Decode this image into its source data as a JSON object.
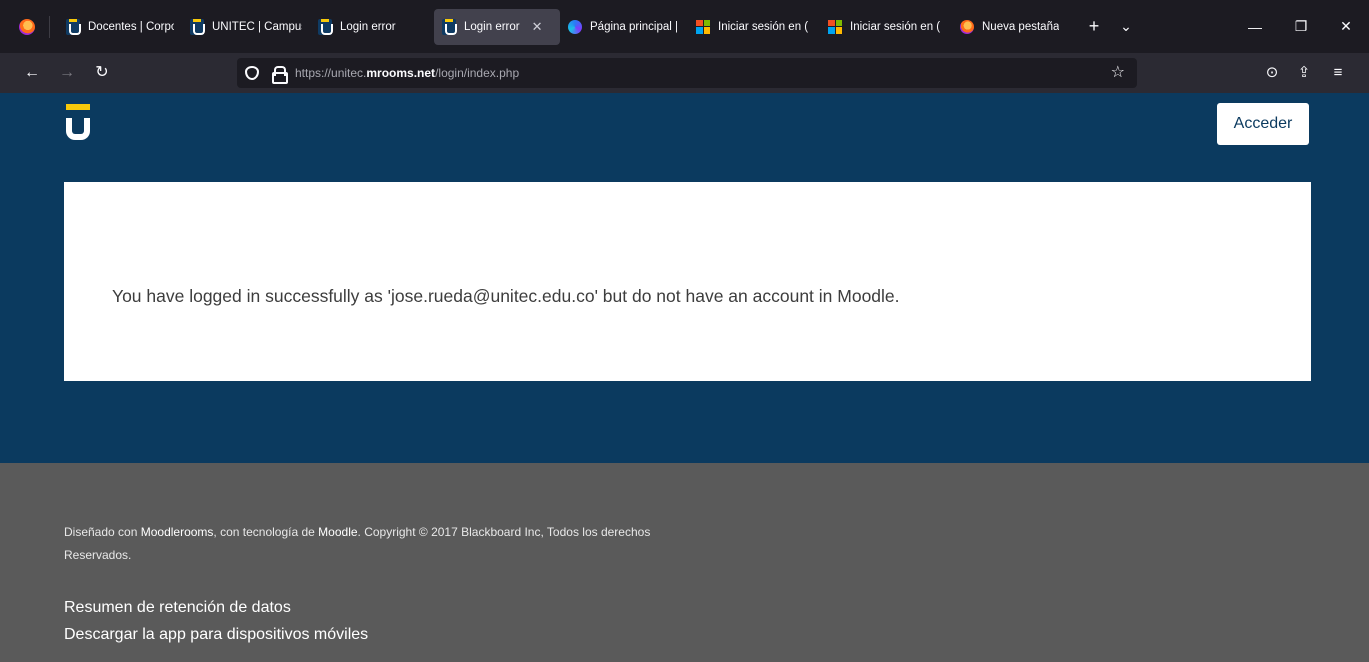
{
  "browser": {
    "tabs": [
      {
        "label": "Docentes | Corpo",
        "favicon": "unitec-icon",
        "active": false
      },
      {
        "label": "UNITEC | Campus",
        "favicon": "unitec-icon",
        "active": false
      },
      {
        "label": "Login error",
        "favicon": "unitec-icon",
        "active": false
      },
      {
        "label": "Login error",
        "favicon": "unitec-icon",
        "active": true
      },
      {
        "label": "Página principal |",
        "favicon": "bing-icon",
        "active": false
      },
      {
        "label": "Iniciar sesión en (",
        "favicon": "microsoft-icon",
        "active": false
      },
      {
        "label": "Iniciar sesión en (",
        "favicon": "microsoft-icon",
        "active": false
      },
      {
        "label": "Nueva pestaña",
        "favicon": "firefox-icon",
        "active": false
      }
    ],
    "new_tab_glyph": "+",
    "tab_list_glyph": "⌄",
    "close_tab_glyph": "✕",
    "window": {
      "minimize": "—",
      "restore": "❐",
      "close": "✕"
    },
    "nav": {
      "back": "←",
      "forward": "→",
      "reload": "↻"
    },
    "url": {
      "prefix": "https://unitec.",
      "domain": "mrooms.net",
      "path": "/login/index.php"
    },
    "bookmark_glyph": "☆",
    "toolbar": {
      "pocket": "⊙",
      "share": "⇪",
      "menu": "≡"
    }
  },
  "header": {
    "login_button": "Acceder"
  },
  "main": {
    "message": "You have logged in successfully as 'jose.rueda@unitec.edu.co' but do not have an account in Moodle."
  },
  "footer": {
    "copy_prefix": "Diseñado con ",
    "copy_link1": "Moodlerooms",
    "copy_mid": ", con tecnología de ",
    "copy_link2": "Moodle",
    "copy_suffix": ". Copyright © 2017 Blackboard Inc, Todos los derechos Reservados.",
    "links": [
      "Resumen de retención de datos",
      "Descargar la app para dispositivos móviles"
    ]
  },
  "colors": {
    "header_bg": "#0b3a5f",
    "accent_yellow": "#f7c90a",
    "footer_bg": "#5a5a5a",
    "browser_tabstrip": "#1c1b22",
    "browser_navbar": "#2b2a33"
  }
}
